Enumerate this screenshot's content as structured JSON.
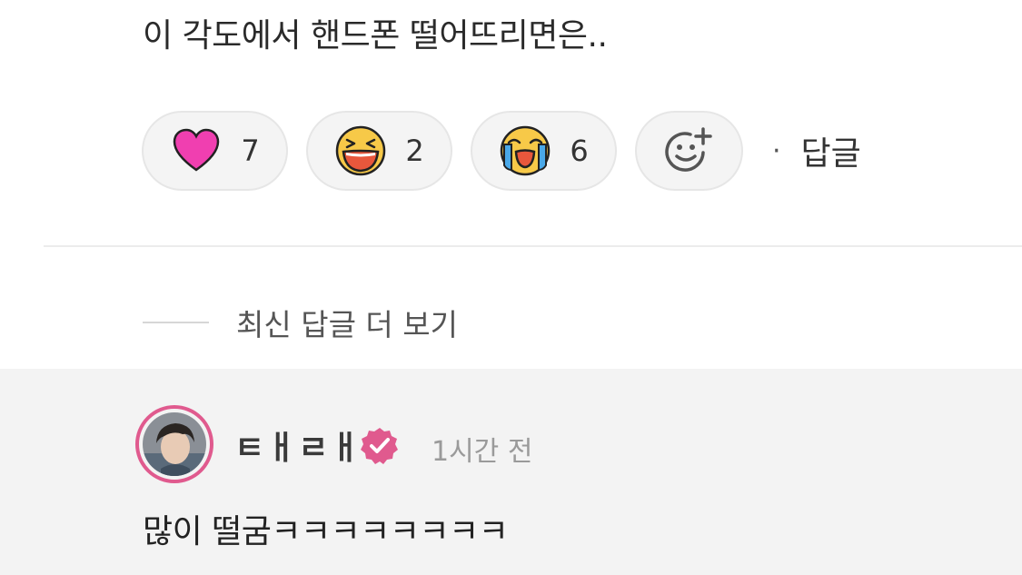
{
  "comment": {
    "text": "이 각도에서 핸드폰 떨어뜨리면은.."
  },
  "reactions": [
    {
      "icon": "heart-icon",
      "count": "7"
    },
    {
      "icon": "laughing-face-icon",
      "count": "2"
    },
    {
      "icon": "crying-face-icon",
      "count": "6"
    }
  ],
  "add_reaction_icon": "add-reaction-icon",
  "separator": "·",
  "reply_label": "답글",
  "more_replies_label": "최신 답글 더 보기",
  "reply": {
    "username": "ㅌㅐㄹㅐ",
    "time": "1시간 전",
    "text": "많이 떨굼ㅋㅋㅋㅋㅋㅋㅋㅋ"
  },
  "colors": {
    "accent_pink": "#e05a8e",
    "heart_pink": "#f03fb0",
    "emoji_yellow": "#f7c948",
    "reply_bg": "#f3f3f3"
  }
}
